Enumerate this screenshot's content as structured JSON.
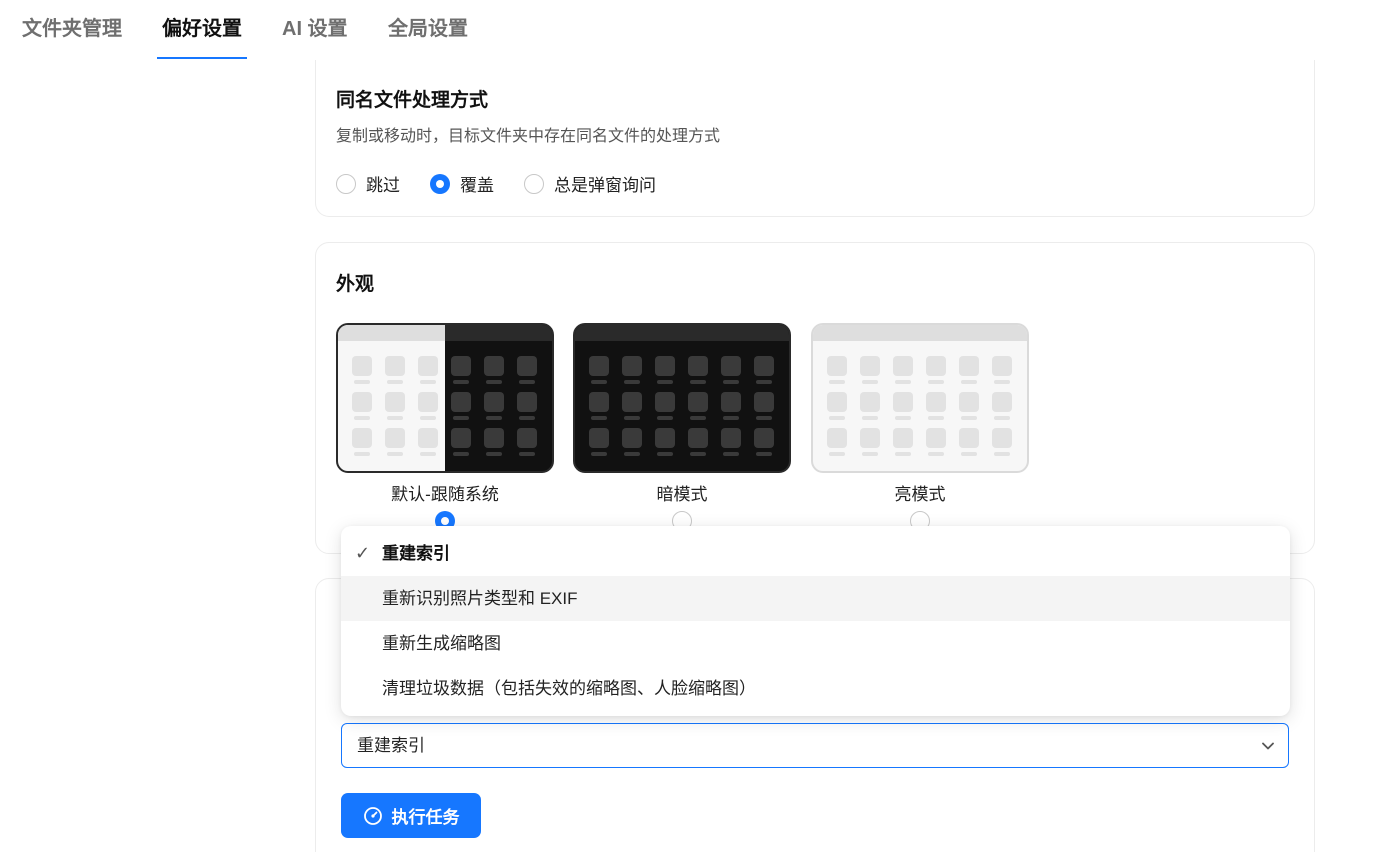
{
  "tabs": [
    {
      "label": "文件夹管理",
      "active": false
    },
    {
      "label": "偏好设置",
      "active": true
    },
    {
      "label": "AI 设置",
      "active": false
    },
    {
      "label": "全局设置",
      "active": false
    }
  ],
  "duplicate_section": {
    "title": "同名文件处理方式",
    "description": "复制或移动时，目标文件夹中存在同名文件的处理方式",
    "options": [
      {
        "label": "跳过",
        "checked": false
      },
      {
        "label": "覆盖",
        "checked": true
      },
      {
        "label": "总是弹窗询问",
        "checked": false
      }
    ]
  },
  "appearance": {
    "title": "外观",
    "themes": [
      {
        "label": "默认-跟随系统",
        "selected": true
      },
      {
        "label": "暗模式",
        "selected": false
      },
      {
        "label": "亮模式",
        "selected": false
      }
    ]
  },
  "task_menu": {
    "items": [
      {
        "label": "重建索引",
        "selected": true
      },
      {
        "label": "重新识别照片类型和 EXIF",
        "selected": false
      },
      {
        "label": "重新生成缩略图",
        "selected": false
      },
      {
        "label": "清理垃圾数据（包括失效的缩略图、人脸缩略图）",
        "selected": false
      }
    ]
  },
  "task_select": {
    "value": "重建索引"
  },
  "run_button": {
    "label": "执行任务"
  },
  "colors": {
    "accent": "#1677ff",
    "dark_bg": "#111111",
    "light_bg": "#f7f7f7"
  }
}
